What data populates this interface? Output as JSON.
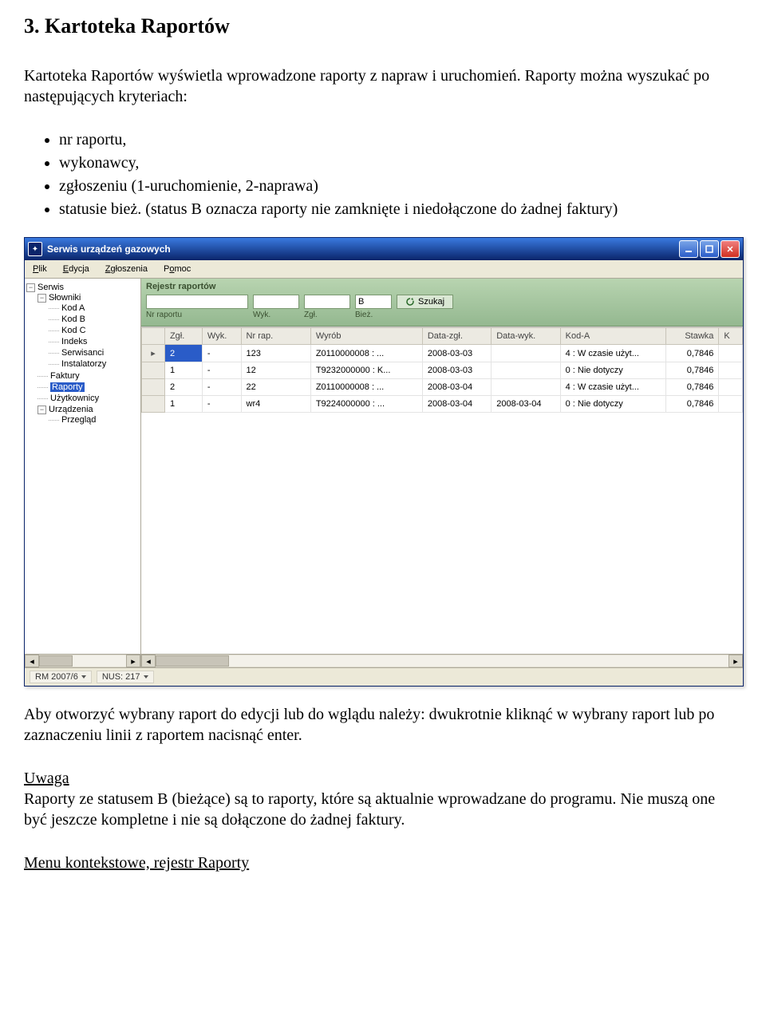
{
  "sec_heading": "3. Kartoteka Raportów",
  "para1": "Kartoteka Raportów wyświetla wprowadzone raporty z napraw i uruchomień. Raporty można wyszukać po następujących kryteriach:",
  "bullets": [
    "nr raportu,",
    "wykonawcy,",
    "zgłoszeniu (1-uruchomienie, 2-naprawa)",
    "statusie bież. (status B oznacza raporty nie zamknięte i niedołączone do żadnej faktury)"
  ],
  "para2": "Aby otworzyć wybrany raport do edycji lub do wglądu należy: dwukrotnie kliknąć w wybrany raport lub po zaznaczeniu linii z raportem nacisnąć enter.",
  "uwaga_label": "Uwaga",
  "para3": "Raporty ze statusem B (bieżące) są to raporty, które są aktualnie wprowadzane do programu. Nie muszą one być jeszcze kompletne i nie są dołączone do żadnej faktury.",
  "menu_label": "Menu kontekstowe, rejestr Raporty",
  "win": {
    "title": "Serwis urządzeń gazowych",
    "menu": {
      "plik": "Plik",
      "edycja": "Edycja",
      "zgloszenia": "Zgłoszenia",
      "pomoc": "Pomoc"
    },
    "tree_serwis": "Serwis",
    "tree_slowniki": "Słowniki",
    "tree_kodA": "Kod A",
    "tree_kodB": "Kod B",
    "tree_kodC": "Kod C",
    "tree_ind": "Indeks",
    "tree_serw": "Serwisanci",
    "tree_inst": "Instalatorzy",
    "tree_fakt": "Faktury",
    "tree_rap": "Raporty",
    "tree_uzyt": "Użytkownicy",
    "tree_urz": "Urządzenia",
    "tree_prz": "Przegląd",
    "filter_title": "Rejestr raportów",
    "filter_biez": "B",
    "filter_search": "Szukaj",
    "filter_lbl_nr": "Nr raportu",
    "filter_lbl_wyk": "Wyk.",
    "filter_lbl_zgl": "Zgł.",
    "filter_lbl_biez": "Bież.",
    "cols": {
      "zgl": "Zgł.",
      "wyk": "Wyk.",
      "nrrap": "Nr rap.",
      "wyrob": "Wyrób",
      "datazgl": "Data-zgł.",
      "datawyk": "Data-wyk.",
      "koda": "Kod-A",
      "stawka": "Stawka",
      "k": "K"
    },
    "rows": [
      {
        "zgl": "2",
        "wyk": "-",
        "nrrap": "123",
        "wyrob": "Z0110000008 : ...",
        "datazgl": "2008-03-03",
        "datawyk": "",
        "koda": "4 : W czasie użyt...",
        "stawka": "0,7846"
      },
      {
        "zgl": "1",
        "wyk": "-",
        "nrrap": "12",
        "wyrob": "T9232000000 : K...",
        "datazgl": "2008-03-03",
        "datawyk": "",
        "koda": "0 : Nie dotyczy",
        "stawka": "0,7846"
      },
      {
        "zgl": "2",
        "wyk": "-",
        "nrrap": "22",
        "wyrob": "Z0110000008 : ...",
        "datazgl": "2008-03-04",
        "datawyk": "",
        "koda": "4 : W czasie użyt...",
        "stawka": "0,7846"
      },
      {
        "zgl": "1",
        "wyk": "-",
        "nrrap": "wr4",
        "wyrob": "T9224000000 : ...",
        "datazgl": "2008-03-04",
        "datawyk": "2008-03-04",
        "koda": "0 : Nie dotyczy",
        "stawka": "0,7846"
      }
    ],
    "status_rm": "RM 2007/6",
    "status_nus": "NUS: 217"
  }
}
